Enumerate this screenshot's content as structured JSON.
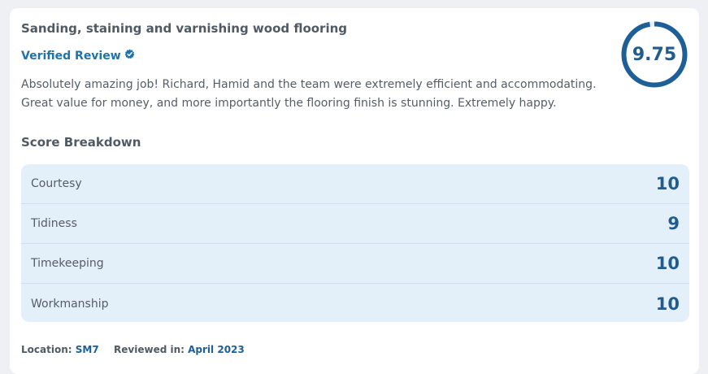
{
  "review": {
    "title": "Sanding, staining and varnishing wood flooring",
    "verified_label": "Verified Review",
    "text": "Absolutely amazing job! Richard, Hamid and the team were extremely efficient and accommodating. Great value for money, and more importantly the flooring finish is stunning. Extremely happy.",
    "overall_score": "9.75",
    "overall_score_fraction": 0.975
  },
  "breakdown": {
    "heading": "Score Breakdown",
    "rows": [
      {
        "label": "Courtesy",
        "score": "10"
      },
      {
        "label": "Tidiness",
        "score": "9"
      },
      {
        "label": "Timekeeping",
        "score": "10"
      },
      {
        "label": "Workmanship",
        "score": "10"
      }
    ]
  },
  "footer": {
    "location_label": "Location:",
    "location_value": "SM7",
    "reviewed_label": "Reviewed in:",
    "reviewed_value": "April 2023"
  },
  "icons": {
    "verified": "verified-check-icon"
  },
  "colors": {
    "accent": "#1f73ad",
    "score": "#205c8e",
    "ring": "#1e5f98",
    "breakdown_bg": "#e3eff9"
  }
}
